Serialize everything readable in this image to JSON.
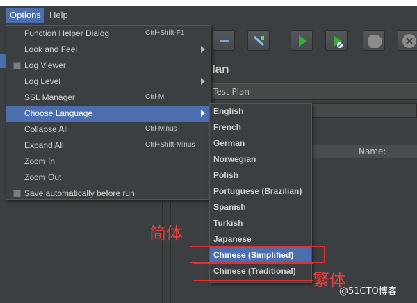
{
  "menubar": {
    "options": "Options",
    "help": "Help"
  },
  "options_menu": [
    {
      "label": "Function Helper Dialog",
      "accel": "Ctrl+Shift-F1"
    },
    {
      "label": "Look and Feel",
      "submenu": true
    },
    {
      "label": "Log Viewer",
      "checkbox": true
    },
    {
      "label": "Log Level",
      "submenu": true
    },
    {
      "label": "SSL Manager",
      "accel": "Ctrl-M"
    },
    {
      "label": "Choose Language",
      "submenu": true,
      "highlighted": true
    },
    {
      "label": "Collapse All",
      "accel": "Ctrl-Minus"
    },
    {
      "label": "Expand All",
      "accel": "Ctrl+Shift-Minus"
    },
    {
      "label": "Zoom In"
    },
    {
      "label": "Zoom Out"
    },
    {
      "label": "Save automatically before run",
      "checkbox": true
    }
  ],
  "language_menu": [
    "English",
    "French",
    "German",
    "Norwegian",
    "Polish",
    "Portuguese (Brazilian)",
    "Spanish",
    "Turkish",
    "Japanese",
    "Chinese (Simplified)",
    "Chinese (Traditional)"
  ],
  "language_highlighted": "Chinese (Simplified)",
  "main": {
    "title_partial": "lan",
    "name_value": "Test Plan",
    "table_header": "Name:"
  },
  "annotations": {
    "simplified": "简体",
    "traditional": "繁体"
  },
  "watermark": "@51CTO博客",
  "colors": {
    "highlight": "#4b6eaf",
    "annotation": "#e03030",
    "background": "#3c3f41"
  },
  "icons": [
    "minus-icon",
    "edit-icon",
    "run-icon",
    "run-no-pause-icon",
    "stop-icon",
    "shutdown-icon"
  ]
}
